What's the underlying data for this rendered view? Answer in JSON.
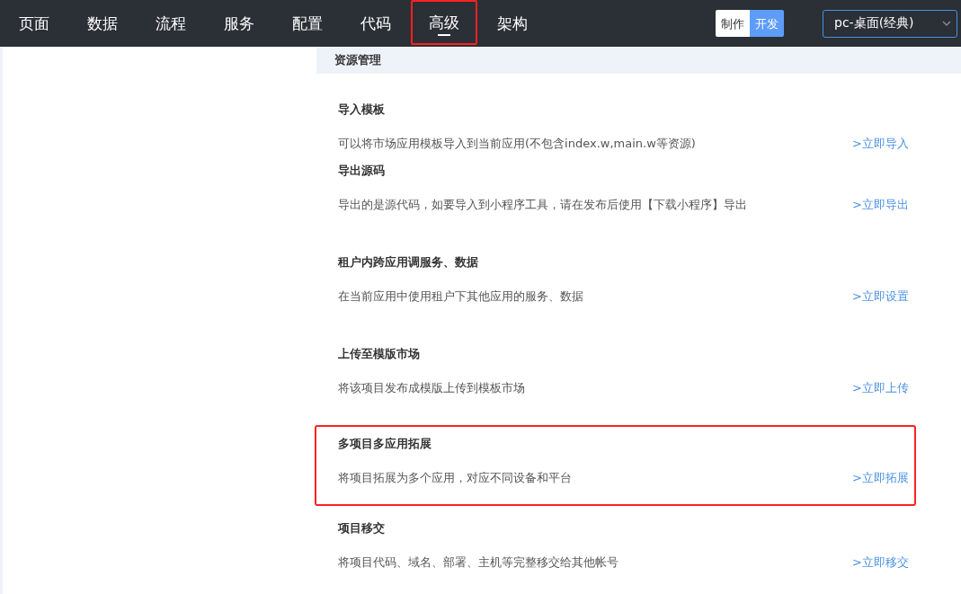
{
  "nav": {
    "tabs": [
      {
        "label": "页面",
        "selected": false,
        "highlighted": false
      },
      {
        "label": "数据",
        "selected": false,
        "highlighted": false
      },
      {
        "label": "流程",
        "selected": false,
        "highlighted": false
      },
      {
        "label": "服务",
        "selected": false,
        "highlighted": false
      },
      {
        "label": "配置",
        "selected": false,
        "highlighted": false
      },
      {
        "label": "代码",
        "selected": false,
        "highlighted": false
      },
      {
        "label": "高级",
        "selected": true,
        "highlighted": true
      },
      {
        "label": "架构",
        "selected": false,
        "highlighted": false
      }
    ],
    "mode_toggle": [
      {
        "label": "制作",
        "selected": false
      },
      {
        "label": "开发",
        "selected": true
      }
    ],
    "device_select": {
      "value": "pc-桌面(经典)"
    }
  },
  "panel": {
    "title": "资源管理",
    "sections": [
      {
        "title": "导入模板",
        "description": "可以将市场应用模板导入到当前应用(不包含index.w,main.w等资源)",
        "link": ">立即导入",
        "highlighted": false
      },
      {
        "title": "导出源码",
        "description": "导出的是源代码，如要导入到小程序工具，请在发布后使用【下载小程序】导出",
        "link": ">立即导出",
        "highlighted": false
      },
      {
        "title": "租户内跨应用调服务、数据",
        "description": "在当前应用中使用租户下其他应用的服务、数据",
        "link": ">立即设置",
        "highlighted": false
      },
      {
        "title": "上传至模版市场",
        "description": "将该项目发布成模版上传到模板市场",
        "link": ">立即上传",
        "highlighted": false
      },
      {
        "title": "多项目多应用拓展",
        "description": "将项目拓展为多个应用，对应不同设备和平台",
        "link": ">立即拓展",
        "highlighted": true
      },
      {
        "title": "项目移交",
        "description": "将项目代码、域名、部署、主机等完整移交给其他帐号",
        "link": ">立即移交",
        "highlighted": false
      }
    ]
  }
}
